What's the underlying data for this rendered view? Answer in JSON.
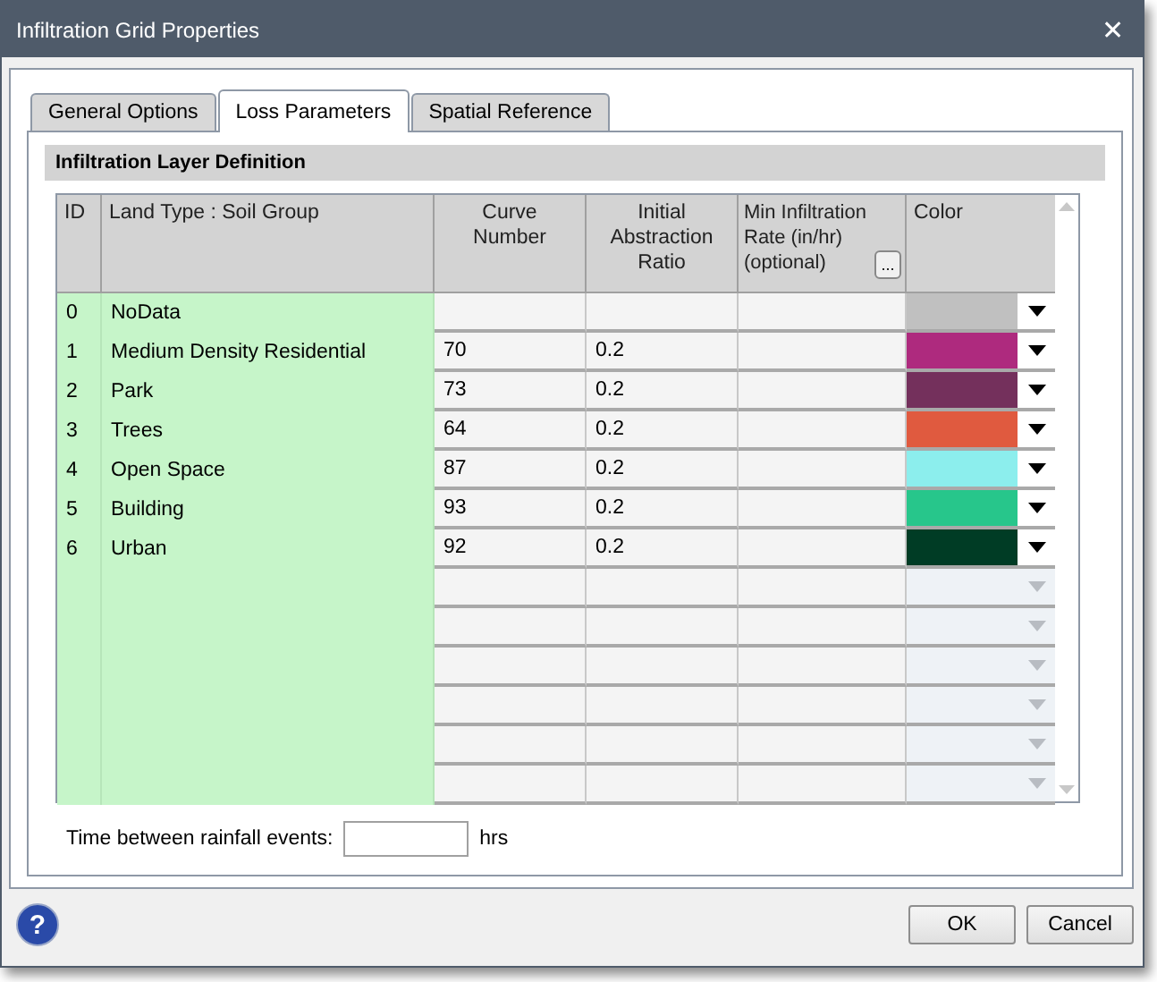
{
  "window": {
    "title": "Infiltration Grid Properties",
    "close": "✕"
  },
  "tabs": [
    {
      "label": "General Options",
      "selected": false
    },
    {
      "label": "Loss Parameters",
      "selected": true
    },
    {
      "label": "Spatial Reference",
      "selected": false
    }
  ],
  "section": {
    "title": "Infiltration Layer Definition"
  },
  "table": {
    "columns": [
      {
        "label": "ID"
      },
      {
        "label": "Land Type : Soil Group"
      },
      {
        "label": "Curve Number"
      },
      {
        "label": "Initial Abstraction Ratio"
      },
      {
        "label": "Min Infiltration Rate (in/hr) (optional)",
        "button": "..."
      },
      {
        "label": "Color"
      }
    ],
    "rows": [
      {
        "id": "0",
        "land_type": "NoData",
        "curve_number": "",
        "abstraction_ratio": "",
        "min_rate": "",
        "color": "#c0c0c0"
      },
      {
        "id": "1",
        "land_type": "Medium Density Residential",
        "curve_number": "70",
        "abstraction_ratio": "0.2",
        "min_rate": "",
        "color": "#ae2a7e"
      },
      {
        "id": "2",
        "land_type": "Park",
        "curve_number": "73",
        "abstraction_ratio": "0.2",
        "min_rate": "",
        "color": "#74305c"
      },
      {
        "id": "3",
        "land_type": "Trees",
        "curve_number": "64",
        "abstraction_ratio": "0.2",
        "min_rate": "",
        "color": "#e05a3f"
      },
      {
        "id": "4",
        "land_type": "Open Space",
        "curve_number": "87",
        "abstraction_ratio": "0.2",
        "min_rate": "",
        "color": "#8ceeed"
      },
      {
        "id": "5",
        "land_type": "Building",
        "curve_number": "93",
        "abstraction_ratio": "0.2",
        "min_rate": "",
        "color": "#27c68b"
      },
      {
        "id": "6",
        "land_type": "Urban",
        "curve_number": "92",
        "abstraction_ratio": "0.2",
        "min_rate": "",
        "color": "#003c25"
      }
    ]
  },
  "rainfall": {
    "label": "Time between rainfall events:",
    "unit": "hrs"
  },
  "buttons": [
    {
      "label": "OK"
    },
    {
      "label": "Cancel"
    }
  ],
  "help": "?"
}
